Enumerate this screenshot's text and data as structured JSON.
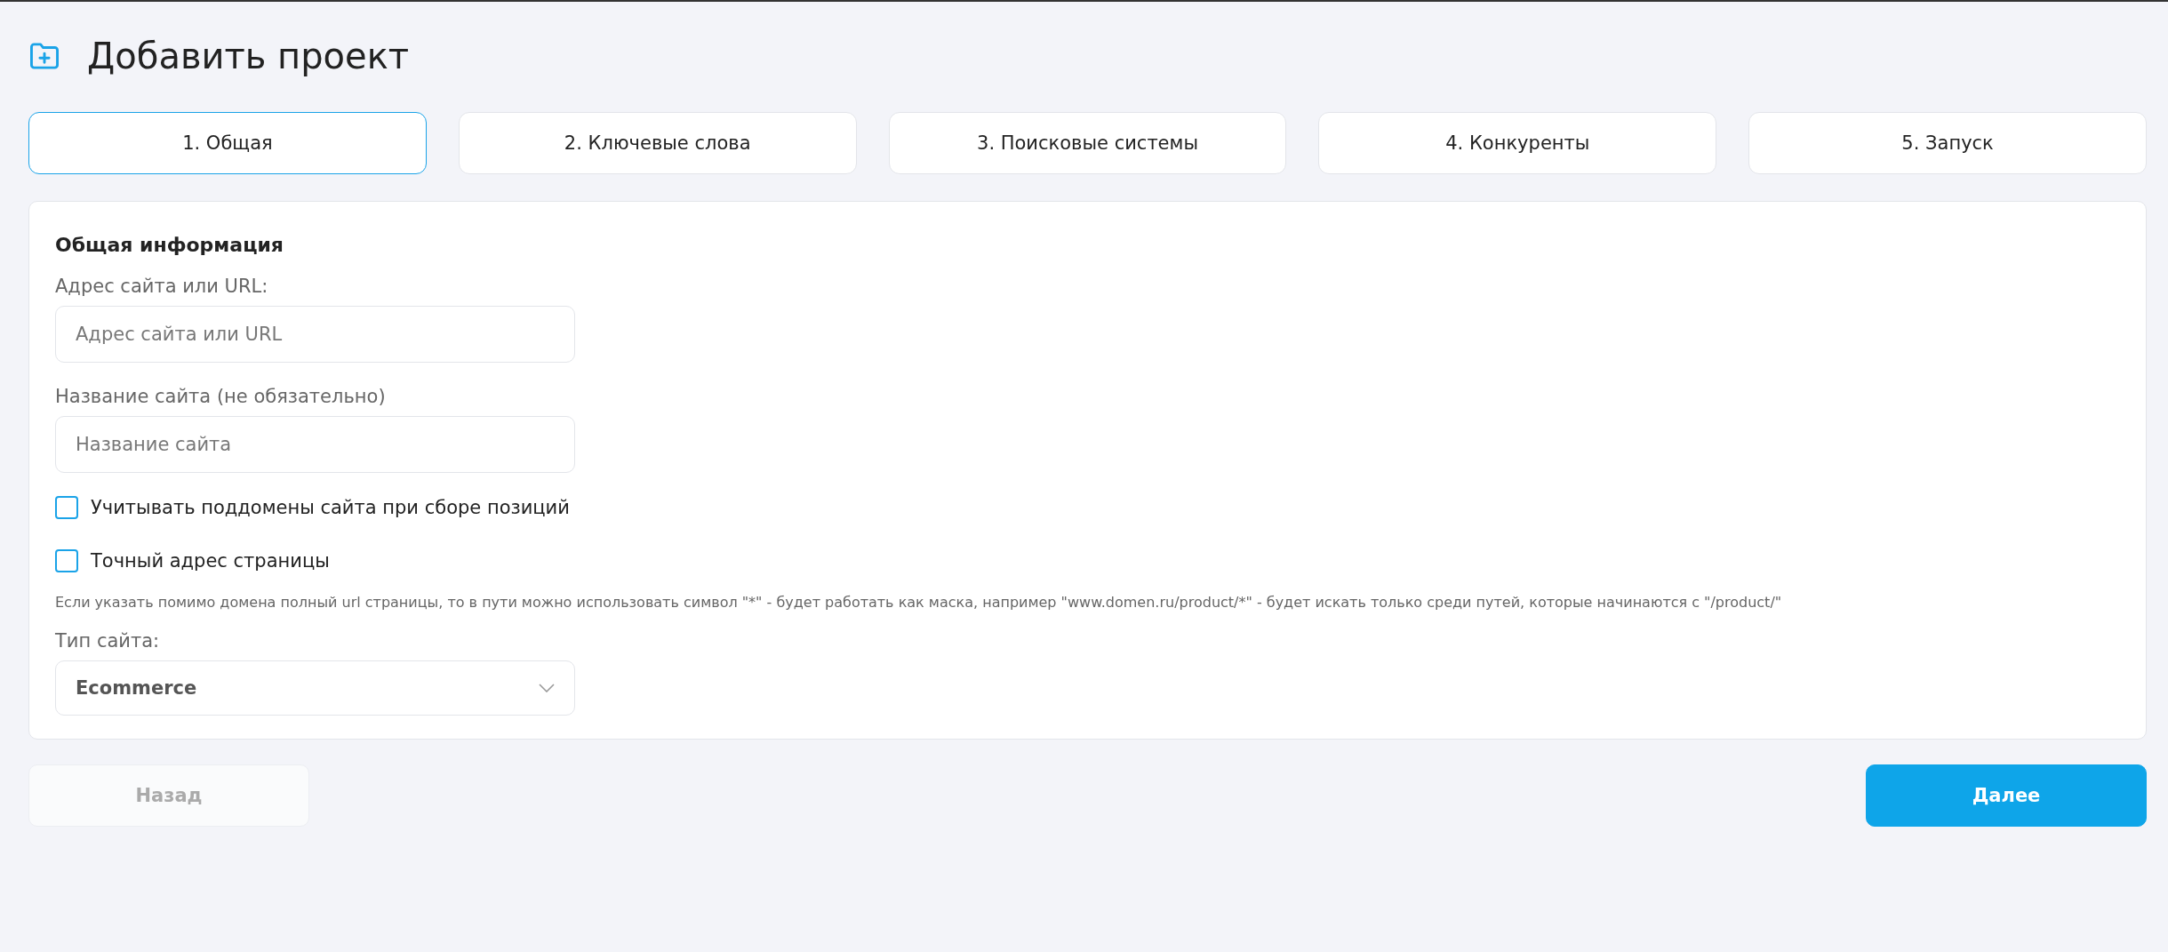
{
  "page": {
    "title": "Добавить проект"
  },
  "tabs": [
    {
      "label": "1. Общая",
      "selected": true
    },
    {
      "label": "2. Ключевые слова",
      "selected": false
    },
    {
      "label": "3. Поисковые системы",
      "selected": false
    },
    {
      "label": "4. Конкуренты",
      "selected": false
    },
    {
      "label": "5. Запуск",
      "selected": false
    }
  ],
  "section": {
    "title": "Общая информация",
    "fields": [
      {
        "label": "Адрес сайта или URL:",
        "placeholder": "Адрес сайта или URL"
      },
      {
        "label": "Название сайта (не обязательно)",
        "placeholder": "Название сайта"
      }
    ],
    "checkboxes": [
      {
        "label": "Учитывать поддомены сайта при сборе позиций",
        "checked": false
      },
      {
        "label": "Точный адрес страницы",
        "checked": false
      }
    ],
    "hint": "Если указать помимо домена полный url страницы, то в пути можно использовать символ \"*\" - будет работать как маска, например \"www.domen.ru/product/*\" - будет искать только среди путей, которые начинаются с \"/product/\"",
    "select": {
      "label": "Тип сайта:",
      "value": "Ecommerce"
    }
  },
  "buttons": {
    "back": {
      "label": "Назад",
      "disabled": true
    },
    "next": {
      "label": "Далее",
      "disabled": false
    }
  }
}
